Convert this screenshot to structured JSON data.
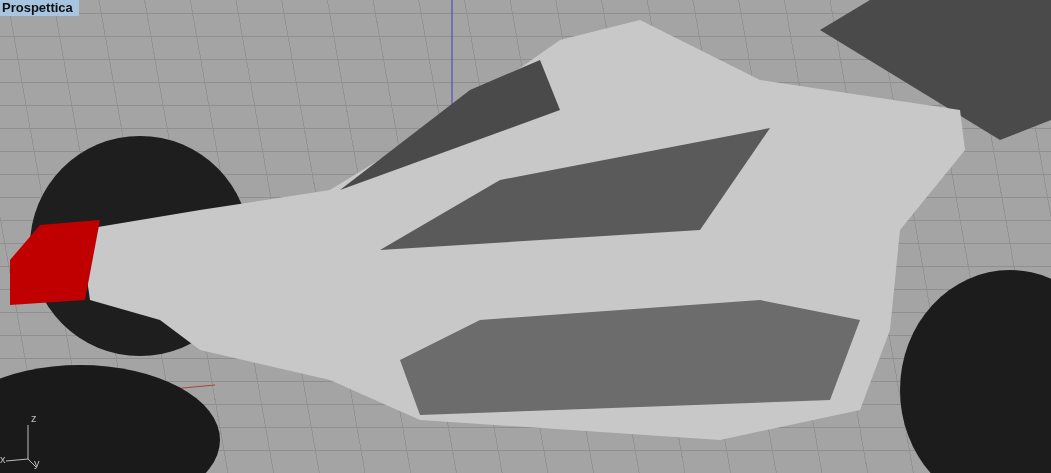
{
  "viewport": {
    "title": "Prospettica",
    "axis_labels": [
      "z",
      "x",
      "y"
    ]
  }
}
